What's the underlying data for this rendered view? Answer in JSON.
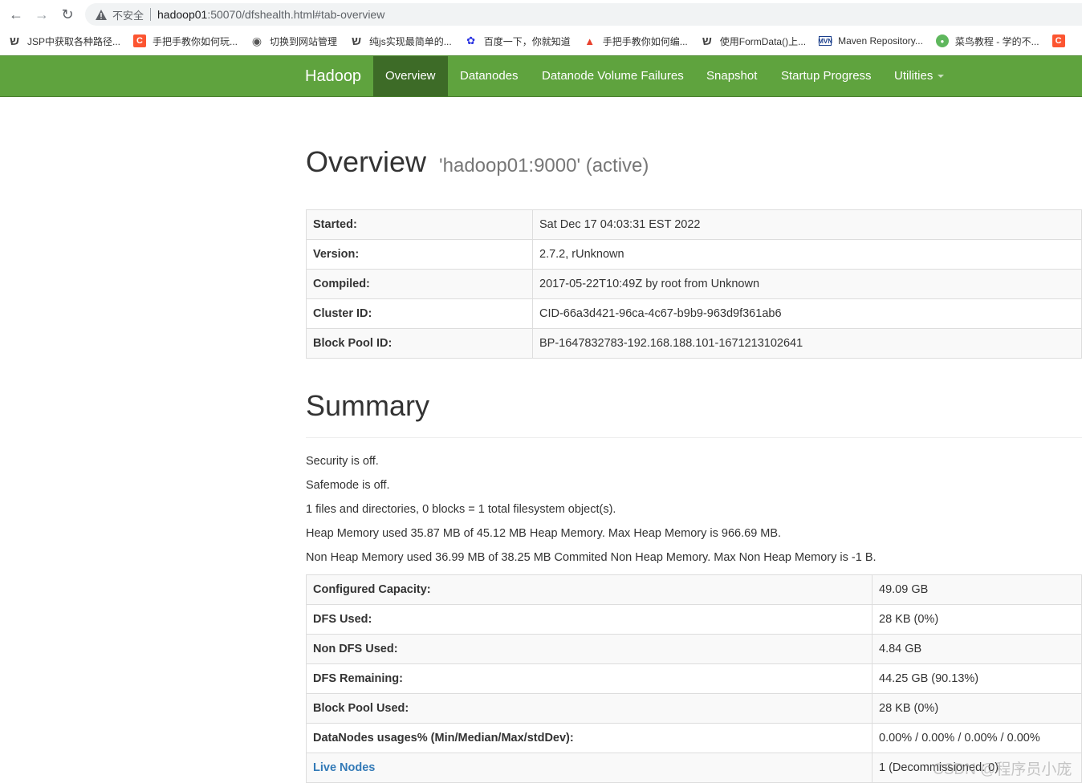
{
  "browser": {
    "insecure_label": "不安全",
    "url_host": "hadoop01",
    "url_rest": ":50070/dfshealth.html#tab-overview",
    "bookmarks": [
      {
        "label": "JSP中获取各种路径...",
        "icon": "script-icon"
      },
      {
        "label": "手把手教你如何玩...",
        "icon": "csdn-icon"
      },
      {
        "label": "切换到网站管理",
        "icon": "globe-icon"
      },
      {
        "label": "纯js实现最简单的...",
        "icon": "script-icon"
      },
      {
        "label": "百度一下，你就知道",
        "icon": "baidu-icon"
      },
      {
        "label": "手把手教你如何编...",
        "icon": "fire-icon"
      },
      {
        "label": "使用FormData()上...",
        "icon": "script-icon"
      },
      {
        "label": "Maven Repository...",
        "icon": "mvn-icon"
      },
      {
        "label": "菜鸟教程 - 学的不...",
        "icon": "runoob-icon"
      }
    ]
  },
  "navbar": {
    "brand": "Hadoop",
    "items": [
      {
        "label": "Overview",
        "active": true
      },
      {
        "label": "Datanodes"
      },
      {
        "label": "Datanode Volume Failures"
      },
      {
        "label": "Snapshot"
      },
      {
        "label": "Startup Progress"
      },
      {
        "label": "Utilities"
      }
    ],
    "color": "#5fa33e"
  },
  "overview": {
    "title": "Overview",
    "subtitle": "'hadoop01:9000' (active)",
    "rows": [
      {
        "key": "Started:",
        "value": "Sat Dec 17 04:03:31 EST 2022"
      },
      {
        "key": "Version:",
        "value": "2.7.2, rUnknown"
      },
      {
        "key": "Compiled:",
        "value": "2017-05-22T10:49Z by root from Unknown"
      },
      {
        "key": "Cluster ID:",
        "value": "CID-66a3d421-96ca-4c67-b9b9-963d9f361ab6"
      },
      {
        "key": "Block Pool ID:",
        "value": "BP-1647832783-192.168.188.101-1671213102641"
      }
    ]
  },
  "summary": {
    "title": "Summary",
    "lines": [
      "Security is off.",
      "Safemode is off.",
      "1 files and directories, 0 blocks = 1 total filesystem object(s).",
      "Heap Memory used 35.87 MB of 45.12 MB Heap Memory. Max Heap Memory is 966.69 MB.",
      "Non Heap Memory used 36.99 MB of 38.25 MB Commited Non Heap Memory. Max Non Heap Memory is -1 B."
    ],
    "rows": [
      {
        "key": "Configured Capacity:",
        "value": "49.09 GB"
      },
      {
        "key": "DFS Used:",
        "value": "28 KB (0%)"
      },
      {
        "key": "Non DFS Used:",
        "value": "4.84 GB"
      },
      {
        "key": "DFS Remaining:",
        "value": "44.25 GB (90.13%)"
      },
      {
        "key": "Block Pool Used:",
        "value": "28 KB (0%)"
      },
      {
        "key": "DataNodes usages% (Min/Median/Max/stdDev):",
        "value": "0.00% / 0.00% / 0.00% / 0.00%"
      },
      {
        "key": "Live Nodes",
        "value": "1 (Decommissioned: 0)"
      }
    ]
  },
  "watermark": "CSDN @程序员小庞"
}
